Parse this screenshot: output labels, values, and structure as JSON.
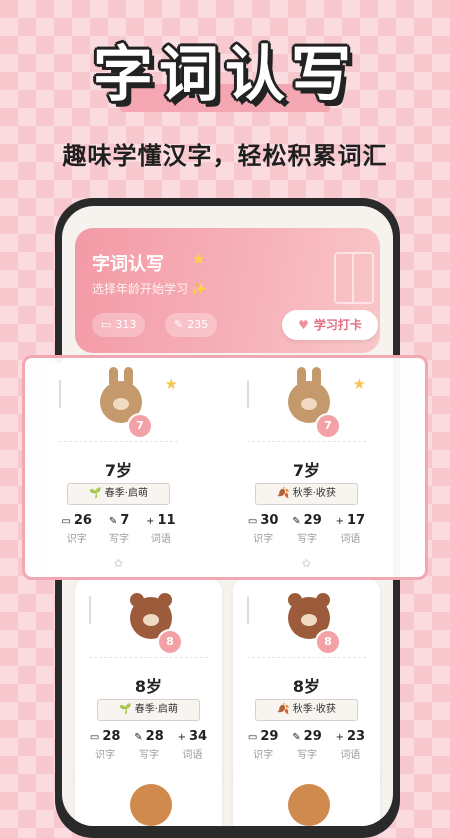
{
  "headline": {
    "title": "字词认写",
    "subtitle": "趣味学懂汉字，轻松积累词汇"
  },
  "header_card": {
    "title": "字词认写",
    "subtitle": "选择年龄开始学习 ✨",
    "stat1": "313",
    "stat2": "235",
    "button_label": "学习打卡"
  },
  "cards": [
    {
      "age": "7岁",
      "badge": "7",
      "season": "🌱 春季·启萌",
      "s1": "26",
      "s2": "7",
      "s3": "11",
      "l1": "识字",
      "l2": "写字",
      "l3": "词语",
      "avatar": "bunny-icon"
    },
    {
      "age": "7岁",
      "badge": "7",
      "season": "🍂 秋季·收获",
      "s1": "30",
      "s2": "29",
      "s3": "17",
      "l1": "识字",
      "l2": "写字",
      "l3": "词语",
      "avatar": "bunny-icon"
    },
    {
      "age": "8岁",
      "badge": "8",
      "season": "🌱 春季·启萌",
      "s1": "28",
      "s2": "28",
      "s3": "34",
      "l1": "识字",
      "l2": "写字",
      "l3": "词语",
      "avatar": "bear-icon"
    },
    {
      "age": "8岁",
      "badge": "8",
      "season": "🍂 秋季·收获",
      "s1": "29",
      "s2": "29",
      "s3": "23",
      "l1": "识字",
      "l2": "写字",
      "l3": "词语",
      "avatar": "bear-icon"
    }
  ],
  "colors": {
    "accent": "#f39aa6",
    "star": "#f3c64e",
    "highlight_border": "#f2a7b3"
  }
}
